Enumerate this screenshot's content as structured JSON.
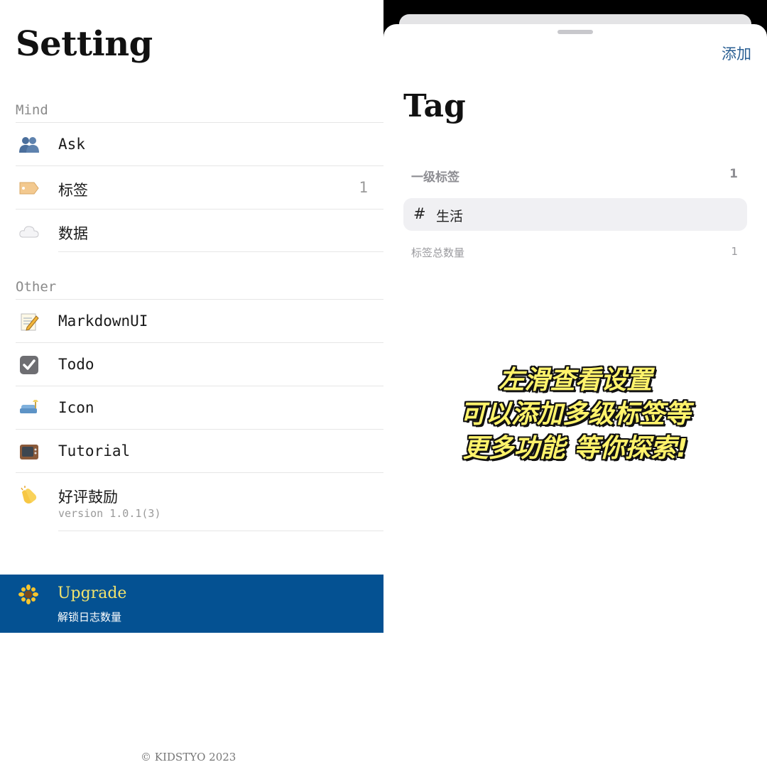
{
  "settings": {
    "title": "Setting",
    "sections": [
      {
        "label": "Mind",
        "items": [
          {
            "label": "Ask",
            "icon": "people-icon"
          },
          {
            "label": "标签",
            "icon": "tag-icon",
            "count": "1"
          },
          {
            "label": "数据",
            "icon": "cloud-icon"
          }
        ]
      },
      {
        "label": "Other",
        "items": [
          {
            "label": "MarkdownUI",
            "icon": "memo-icon"
          },
          {
            "label": "Todo",
            "icon": "checkbox-icon"
          },
          {
            "label": "Icon",
            "icon": "couch-icon"
          },
          {
            "label": "Tutorial",
            "icon": "tv-icon"
          },
          {
            "label": "好评鼓励",
            "icon": "clap-icon",
            "sub": "version 1.0.1(3)"
          }
        ]
      }
    ],
    "upgrade": {
      "title": "Upgrade",
      "subtitle": "解锁日志数量",
      "icon": "sunflower-icon"
    },
    "footer": "© KIDSTYO 2023",
    "colors": {
      "upgrade_bg": "#045192",
      "upgrade_title": "#f1e36e"
    }
  },
  "tag_sheet": {
    "add_label": "添加",
    "title": "Tag",
    "group_label": "一级标签",
    "group_count": "1",
    "tags": [
      {
        "hash": "#",
        "name": "生活"
      }
    ],
    "total_label": "标签总数量",
    "total_count": "1",
    "colors": {
      "accent": "#2a5f93"
    }
  },
  "caption": {
    "lines": [
      "左滑查看设置",
      "可以添加多级标签等",
      "更多功能 等你探索!"
    ]
  }
}
